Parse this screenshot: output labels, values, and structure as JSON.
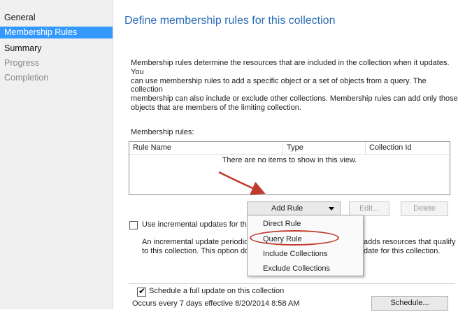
{
  "sidebar": {
    "items": [
      {
        "label": "General",
        "state": "normal"
      },
      {
        "label": "Membership Rules",
        "state": "active"
      },
      {
        "label": "Summary",
        "state": "normal"
      },
      {
        "label": "Progress",
        "state": "dim"
      },
      {
        "label": "Completion",
        "state": "dim"
      }
    ]
  },
  "main": {
    "title": "Define membership rules for this collection",
    "description_lines": [
      "Membership rules determine the resources that are included in the collection when it updates. You",
      "can use membership rules to add a specific object or a set of objects from a query. The collection",
      "membership can also include or exclude other collections. Membership rules can add only those",
      "objects that are members of the limiting collection."
    ],
    "rules_label": "Membership rules:",
    "columns": [
      "Rule Name",
      "Type",
      "Collection Id"
    ],
    "empty_message": "There are no items to show in this view.",
    "buttons": {
      "add_rule": "Add Rule",
      "edit": "Edit...",
      "delete": "Delete",
      "schedule": "Schedule..."
    },
    "incremental": {
      "label": "Use incremental updates for this c",
      "desc_left": [
        "An incremental update periodicall",
        "to this collection. This option doe"
      ],
      "desc_right": [
        "adds resources that qualify",
        "date for this collection."
      ]
    },
    "dropdown_items": [
      "Direct Rule",
      "Query Rule",
      "Include Collections",
      "Exclude Collections"
    ],
    "schedule": {
      "label": "Schedule a full update on this collection",
      "occurs": "Occurs every 7 days effective 8/20/2014 8:58 AM"
    }
  },
  "colors": {
    "accent": "#3399ff",
    "title": "#2a6db3",
    "annotation": "#c0392b"
  }
}
